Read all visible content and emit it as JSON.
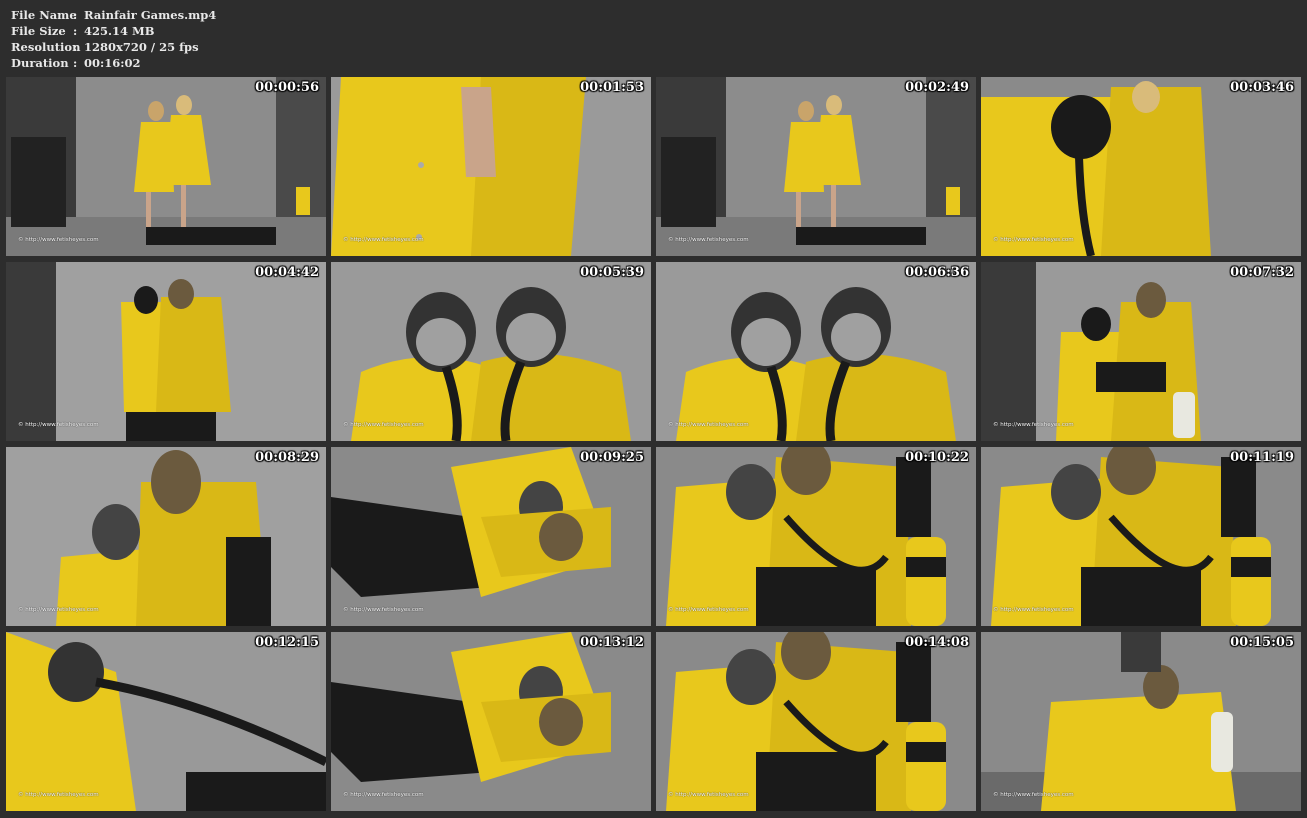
{
  "file_info": [
    {
      "key": "File Name",
      "sep": ":",
      "value": "Rainfair Games.mp4"
    },
    {
      "key": "File Size",
      "sep": ":",
      "value": "425.14 MB"
    },
    {
      "key": "Resolution",
      "sep": ":",
      "value": "1280x720 / 25 fps"
    },
    {
      "key": "Duration",
      "sep": ":",
      "value": "00:16:02"
    }
  ],
  "watermark": "© http://www.fetisheyes.com",
  "colors": {
    "background": "#2d2d2d",
    "raincoat_yellow": "#e8c81c",
    "rubber_black": "#1a1a1a",
    "studio_backdrop": "#8c8c8c"
  },
  "thumbnails": [
    {
      "time": "00:00:56",
      "scene": "two-standing-wide"
    },
    {
      "time": "00:01:53",
      "scene": "coat-closeup"
    },
    {
      "time": "00:02:49",
      "scene": "two-standing-wide"
    },
    {
      "time": "00:03:46",
      "scene": "coat-mask-closeup"
    },
    {
      "time": "00:04:42",
      "scene": "two-standing-medium"
    },
    {
      "time": "00:05:39",
      "scene": "two-masks-closeup"
    },
    {
      "time": "00:06:36",
      "scene": "two-masks-closeup"
    },
    {
      "time": "00:07:32",
      "scene": "two-standing-tank"
    },
    {
      "time": "00:08:29",
      "scene": "two-masks-medium"
    },
    {
      "time": "00:09:25",
      "scene": "floor-lying"
    },
    {
      "time": "00:10:22",
      "scene": "seated-tank"
    },
    {
      "time": "00:11:19",
      "scene": "seated-tank"
    },
    {
      "time": "00:12:15",
      "scene": "hood-hose"
    },
    {
      "time": "00:13:12",
      "scene": "floor-lying"
    },
    {
      "time": "00:14:08",
      "scene": "seated-tank"
    },
    {
      "time": "00:15:05",
      "scene": "floor-tank"
    }
  ]
}
